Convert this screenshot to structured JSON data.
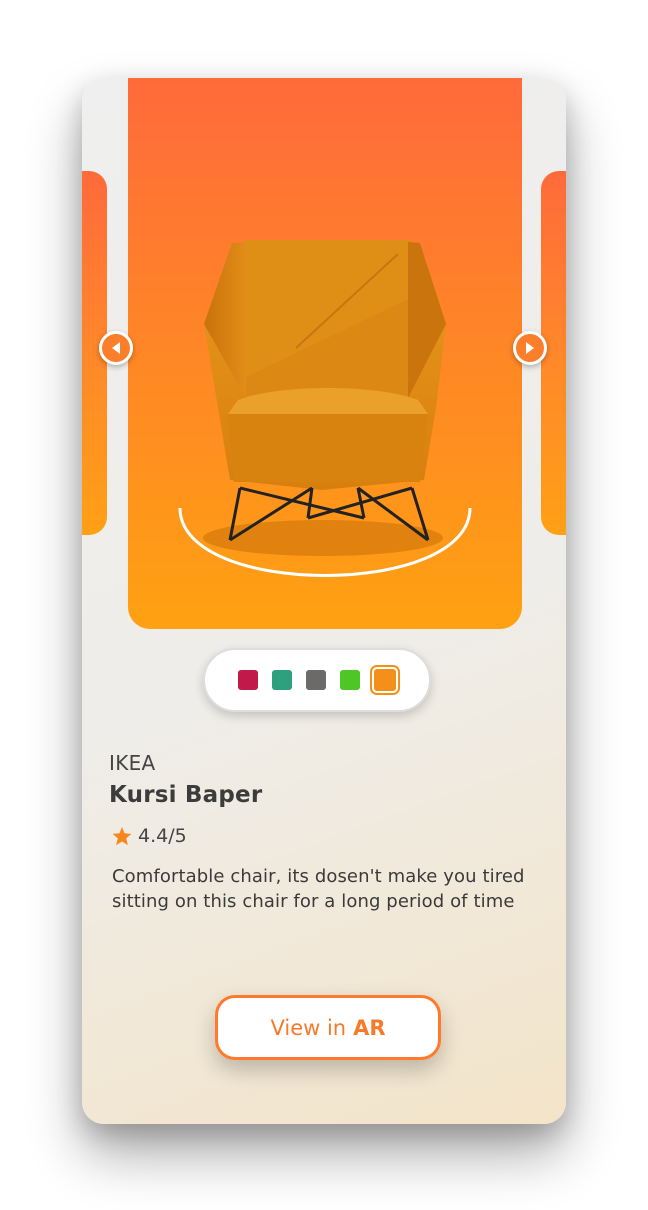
{
  "product": {
    "brand": "IKEA",
    "name": "Kursi Baper",
    "rating": "4.4/5",
    "description": "Comfortable chair, its dosen't make you tired sitting on this chair for a long period of time"
  },
  "colors": {
    "accent": "#ff7a2e",
    "hero_gradient": [
      "#ff6a3b",
      "#ffa112"
    ],
    "options": [
      "#c2194b",
      "#2ea07e",
      "#6b6a69",
      "#4ec726",
      "#f3901a"
    ],
    "selected_index": 4
  },
  "cta": {
    "prefix": "View in",
    "emphasis": "AR"
  },
  "icons": {
    "prev": "chevron-left-icon",
    "next": "chevron-right-icon",
    "rating": "star-icon"
  }
}
